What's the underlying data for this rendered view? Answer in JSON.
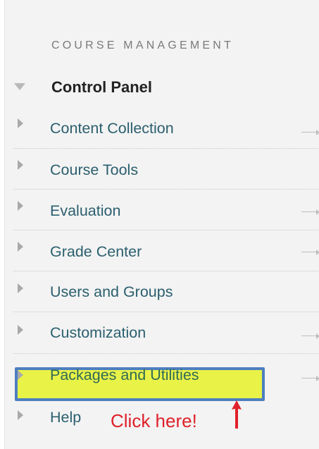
{
  "section": {
    "title": "COURSE MANAGEMENT"
  },
  "control_panel": {
    "label": "Control Panel"
  },
  "menu_items": [
    {
      "label": "Content Collection"
    },
    {
      "label": "Course Tools"
    },
    {
      "label": "Evaluation"
    },
    {
      "label": "Grade Center"
    },
    {
      "label": "Users and Groups"
    },
    {
      "label": "Customization"
    },
    {
      "label": "Packages and Utilities"
    },
    {
      "label": "Help"
    }
  ],
  "annotation": {
    "text": "Click here!",
    "color": "#e0202a"
  },
  "colors": {
    "highlight_fill": "#e9f247",
    "highlight_border": "#4d7fbf",
    "link": "#2b5f6e"
  }
}
